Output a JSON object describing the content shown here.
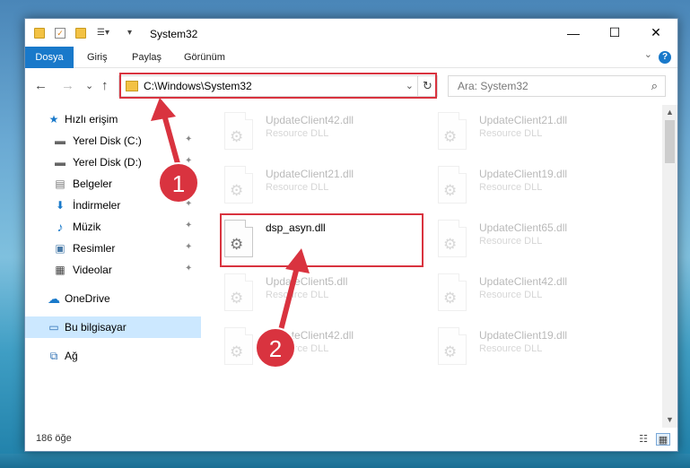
{
  "window": {
    "title": "System32",
    "minimize_glyph": "—",
    "maximize_glyph": "☐",
    "close_glyph": "✕"
  },
  "ribbon": {
    "tabs": [
      "Dosya",
      "Giriş",
      "Paylaş",
      "Görünüm"
    ],
    "help_label": "?",
    "collapse_glyph": "⌄"
  },
  "nav": {
    "back_glyph": "←",
    "forward_glyph": "→",
    "recent_glyph": "⌄",
    "up_glyph": "↑",
    "address": "C:\\Windows\\System32",
    "address_dropdown_glyph": "⌄",
    "refresh_glyph": "↻",
    "search_placeholder": "Ara: System32",
    "search_icon_glyph": "⌕"
  },
  "sidebar": {
    "items": [
      {
        "label": "Hızlı erişim",
        "icon": "star-icon",
        "glyph": "★",
        "pinned": false
      },
      {
        "label": "Yerel Disk (C:)",
        "icon": "drive-icon",
        "glyph": "▬",
        "pinned": true
      },
      {
        "label": "Yerel Disk (D:)",
        "icon": "drive-icon",
        "glyph": "▬",
        "pinned": true
      },
      {
        "label": "Belgeler",
        "icon": "document-icon",
        "glyph": "▤",
        "pinned": true
      },
      {
        "label": "İndirmeler",
        "icon": "download-icon",
        "glyph": "⬇",
        "pinned": true
      },
      {
        "label": "Müzik",
        "icon": "music-icon",
        "glyph": "♪",
        "pinned": true
      },
      {
        "label": "Resimler",
        "icon": "pictures-icon",
        "glyph": "▣",
        "pinned": true
      },
      {
        "label": "Videolar",
        "icon": "video-icon",
        "glyph": "▦",
        "pinned": true
      },
      {
        "label": "OneDrive",
        "icon": "cloud-icon",
        "glyph": "☁",
        "pinned": false
      },
      {
        "label": "Bu bilgisayar",
        "icon": "computer-icon",
        "glyph": "▭",
        "pinned": false,
        "selected": true
      },
      {
        "label": "Ağ",
        "icon": "network-icon",
        "glyph": "⧉",
        "pinned": false
      }
    ],
    "pin_glyph": "✦"
  },
  "files": [
    {
      "name": "UpdateClient42.dll",
      "type": "Resource DLL",
      "faded": true
    },
    {
      "name": "UpdateClient21.dll",
      "type": "Resource DLL",
      "faded": true
    },
    {
      "name": "UpdateClient21.dll",
      "type": "Resource DLL",
      "faded": true
    },
    {
      "name": "UpdateClient19.dll",
      "type": "Resource DLL",
      "faded": true
    },
    {
      "name": "dsp_asyn.dll",
      "type": "",
      "faded": false
    },
    {
      "name": "UpdateClient65.dll",
      "type": "Resource DLL",
      "faded": true
    },
    {
      "name": "UpdateClient5.dll",
      "type": "Resource DLL",
      "faded": true
    },
    {
      "name": "UpdateClient42.dll",
      "type": "Resource DLL",
      "faded": true
    },
    {
      "name": "UpdateClient42.dll",
      "type": "Resource DLL",
      "faded": true
    },
    {
      "name": "UpdateClient19.dll",
      "type": "Resource DLL",
      "faded": true
    }
  ],
  "status": {
    "item_count": "186 öğe",
    "details_view_glyph": "☷",
    "icons_view_glyph": "▦"
  },
  "annotations": {
    "step1": "1",
    "step2": "2",
    "color": "#d9333f"
  }
}
